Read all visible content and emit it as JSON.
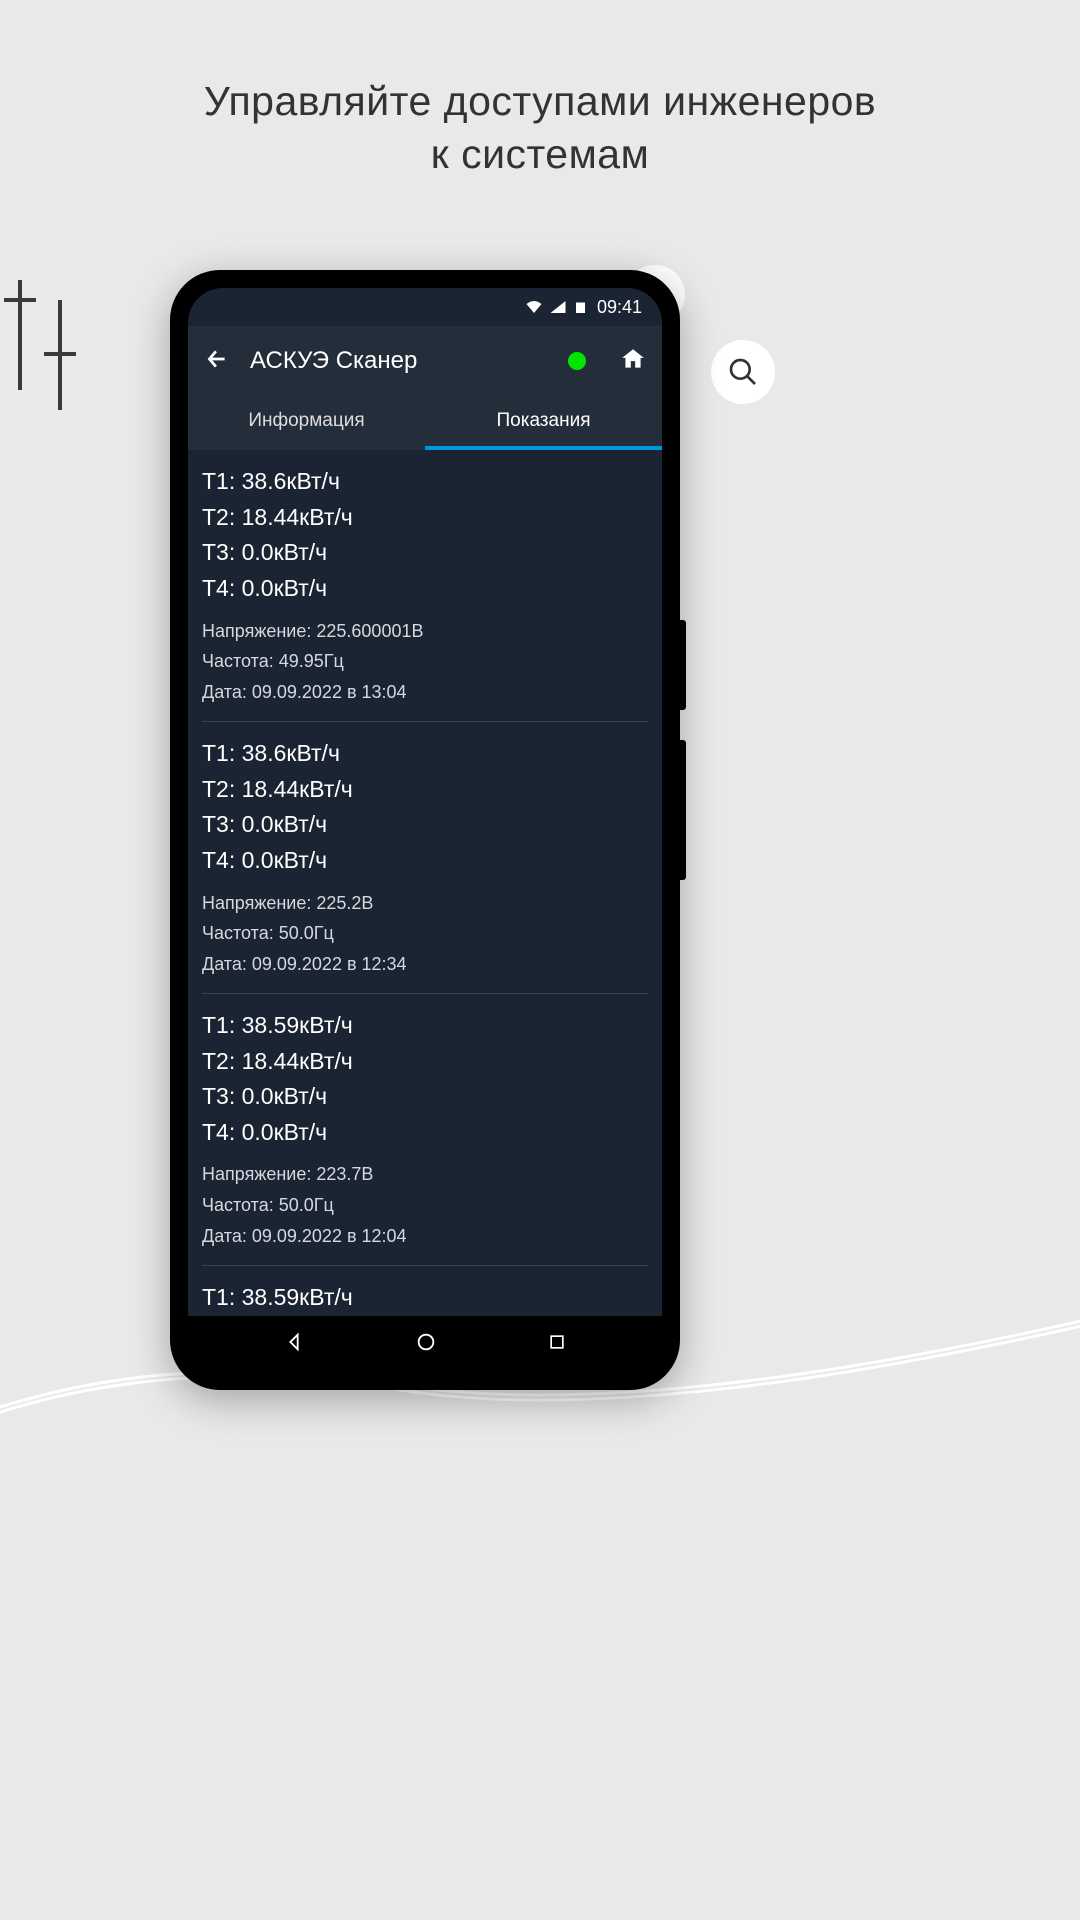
{
  "caption_line1": "Управляйте доступами инженеров",
  "caption_line2": "к системам",
  "statusbar": {
    "time": "09:41"
  },
  "appbar": {
    "title": "АСКУЭ Сканер"
  },
  "tabs": {
    "info": "Информация",
    "readings": "Показания"
  },
  "labels": {
    "voltage": "Напряжение: ",
    "frequency": "Частота: ",
    "date_prefix": "Дата: ",
    "date_at": " в "
  },
  "units": {
    "energy": "кВт/ч",
    "voltage": "В",
    "frequency": "Гц"
  },
  "readings": [
    {
      "t1": "38.6",
      "t2": "18.44",
      "t3": "0.0",
      "t4": "0.0",
      "voltage": "225.600001",
      "frequency": "49.95",
      "date": "09.09.2022",
      "time": "13:04"
    },
    {
      "t1": "38.6",
      "t2": "18.44",
      "t3": "0.0",
      "t4": "0.0",
      "voltage": "225.2",
      "frequency": "50.0",
      "date": "09.09.2022",
      "time": "12:34"
    },
    {
      "t1": "38.59",
      "t2": "18.44",
      "t3": "0.0",
      "t4": "0.0",
      "voltage": "223.7",
      "frequency": "50.0",
      "date": "09.09.2022",
      "time": "12:04"
    },
    {
      "t1": "38.59"
    }
  ]
}
